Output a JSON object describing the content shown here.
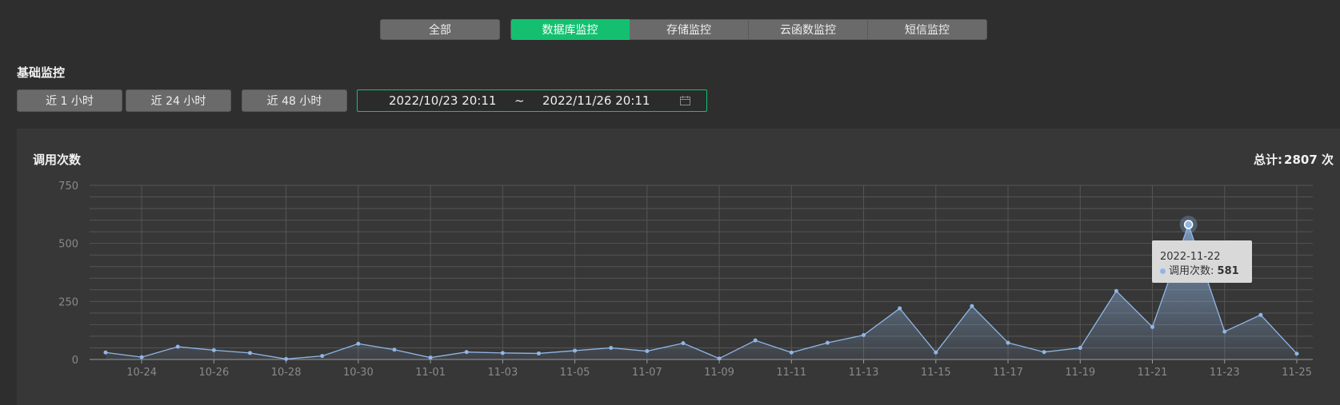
{
  "tabs": {
    "all": "全部",
    "items": [
      "数据库监控",
      "存储监控",
      "云函数监控",
      "短信监控"
    ],
    "active": "数据库监控"
  },
  "section_title": "基础监控",
  "range_buttons": [
    "近 1 小时",
    "近 24 小时",
    "近 48 小时"
  ],
  "date_range": {
    "start": "2022/10/23 20:11",
    "separator": "~",
    "end": "2022/11/26 20:11"
  },
  "panel": {
    "title": "调用次数",
    "total_label": "总计:",
    "total_value": "2807 次"
  },
  "tooltip": {
    "date": "2022-11-22",
    "label": "调用次数:",
    "value": "581"
  },
  "colors": {
    "accent": "#14c06f",
    "series": "#8fb6e6"
  },
  "chart_data": {
    "type": "area",
    "title": "调用次数",
    "xlabel": "",
    "ylabel": "",
    "ylim": [
      0,
      750
    ],
    "yticks": [
      0,
      250,
      500,
      750
    ],
    "grid": true,
    "x": [
      "10-23",
      "10-24",
      "10-25",
      "10-26",
      "10-27",
      "10-28",
      "10-29",
      "10-30",
      "10-31",
      "11-01",
      "11-02",
      "11-03",
      "11-04",
      "11-05",
      "11-06",
      "11-07",
      "11-08",
      "11-09",
      "11-10",
      "11-11",
      "11-12",
      "11-13",
      "11-14",
      "11-15",
      "11-16",
      "11-17",
      "11-18",
      "11-19",
      "11-20",
      "11-21",
      "11-22",
      "11-23",
      "11-24",
      "11-25"
    ],
    "xtick_labels": [
      "10-24",
      "10-26",
      "10-28",
      "10-30",
      "11-01",
      "11-03",
      "11-05",
      "11-07",
      "11-09",
      "11-11",
      "11-13",
      "11-15",
      "11-17",
      "11-19",
      "11-21",
      "11-23",
      "11-25"
    ],
    "series": [
      {
        "name": "调用次数",
        "values": [
          30,
          10,
          55,
          40,
          28,
          2,
          15,
          68,
          42,
          8,
          32,
          28,
          26,
          38,
          50,
          36,
          70,
          4,
          82,
          30,
          72,
          105,
          220,
          30,
          230,
          72,
          32,
          50,
          295,
          140,
          581,
          120,
          192,
          25
        ]
      }
    ],
    "highlight": {
      "x": "11-22",
      "value": 581
    }
  }
}
